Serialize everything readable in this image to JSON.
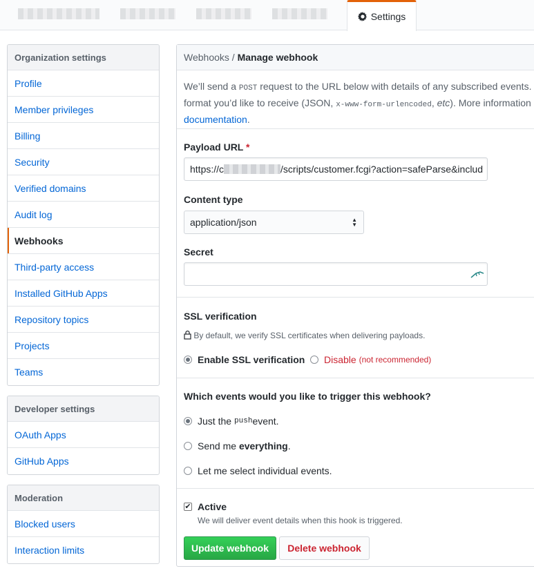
{
  "header": {
    "settings_tab": "Settings",
    "settings_icon": "gear-icon"
  },
  "org_menu": {
    "heading": "Organization settings",
    "items": [
      "Profile",
      "Member privileges",
      "Billing",
      "Security",
      "Verified domains",
      "Audit log",
      "Webhooks",
      "Third-party access",
      "Installed GitHub Apps",
      "Repository topics",
      "Projects",
      "Teams"
    ],
    "selected": "Webhooks"
  },
  "dev_menu": {
    "heading": "Developer settings",
    "items": [
      "OAuth Apps",
      "GitHub Apps"
    ]
  },
  "mod_menu": {
    "heading": "Moderation",
    "items": [
      "Blocked users",
      "Interaction limits"
    ]
  },
  "main": {
    "breadcrumb_parent": "Webhooks",
    "breadcrumb_sep": "/",
    "breadcrumb_current": "Manage webhook",
    "intro_line1_a": "We’ll send a ",
    "intro_line1_code": "POST",
    "intro_line1_b": " request to the URL below with details of any subscribed events. Y",
    "intro_line2_a": "format you’d like to receive (JSON, ",
    "intro_line2_code": "x-www-form-urlencoded",
    "intro_line2_b": ", ",
    "intro_line2_etc": "etc",
    "intro_line2_c": "). More information c",
    "intro_link": "documentation",
    "intro_end": ".",
    "payload_label": "Payload URL",
    "required_mark": "*",
    "payload_prefix": "https://c",
    "payload_suffix": "/scripts/customer.fcgi?action=safeParse&includ",
    "content_type_label": "Content type",
    "content_type_value": "application/json",
    "secret_label": "Secret",
    "secret_value": "",
    "ssl_label": "SSL verification",
    "ssl_note": "By default, we verify SSL certificates when delivering payloads.",
    "ssl_enable": "Enable SSL verification",
    "ssl_disable": "Disable",
    "ssl_disable_note": "(not recommended)",
    "events_label": "Which events would you like to trigger this webhook?",
    "event_push_a": "Just the ",
    "event_push_code": "push",
    "event_push_b": " event.",
    "event_all_a": "Send me ",
    "event_all_b": "everything",
    "event_all_c": ".",
    "event_select": "Let me select individual events.",
    "active_label": "Active",
    "active_note": "We will deliver event details when this hook is triggered.",
    "update_button": "Update webhook",
    "delete_button": "Delete webhook"
  }
}
